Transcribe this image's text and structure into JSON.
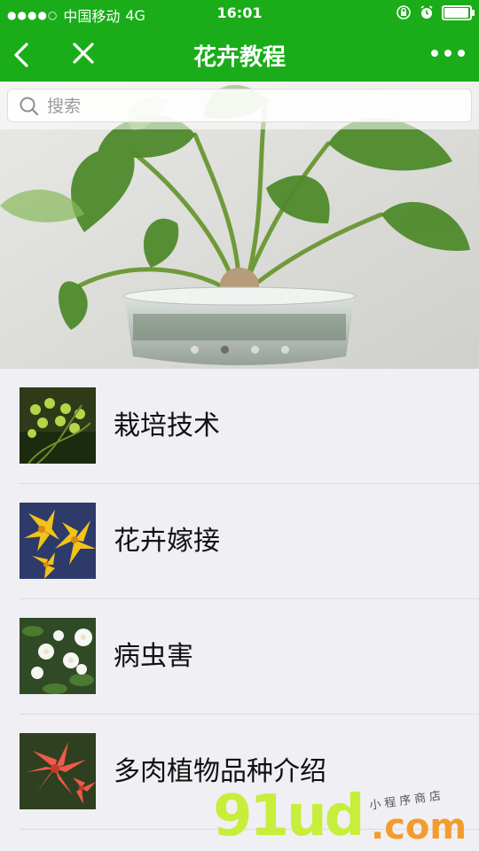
{
  "status_bar": {
    "carrier": "中国移动",
    "network": "4G",
    "time": "16:01"
  },
  "nav": {
    "title": "花卉教程",
    "back_icon": "back-chevron-icon",
    "close_icon": "close-icon",
    "more_icon": "more-dots-icon"
  },
  "search": {
    "placeholder": "搜索",
    "icon": "search-icon"
  },
  "banner": {
    "slide_count": 4,
    "active_index": 1
  },
  "list": {
    "items": [
      {
        "label": "栽培技术",
        "thumb": "green-orchid-photo"
      },
      {
        "label": "花卉嫁接",
        "thumb": "yellow-lily-photo"
      },
      {
        "label": "病虫害",
        "thumb": "white-gardenia-photo"
      },
      {
        "label": "多肉植物品种介绍",
        "thumb": "red-lily-photo"
      }
    ]
  },
  "watermark": {
    "brand": "91ud",
    "domain": ".com",
    "tagline": "小程序商店"
  },
  "colors": {
    "brand_green": "#1aad19",
    "watermark_lime": "#c6ee3a",
    "watermark_orange": "#f39c2b"
  }
}
